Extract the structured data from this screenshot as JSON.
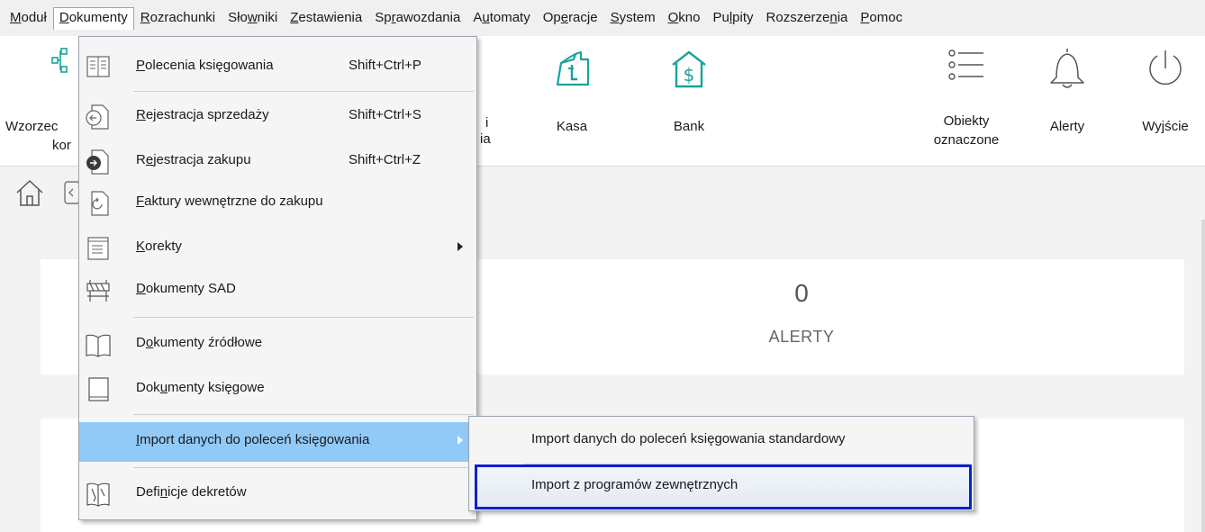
{
  "menubar": {
    "items": [
      {
        "pre": "",
        "u": "M",
        "post": "oduł"
      },
      {
        "pre": "",
        "u": "D",
        "post": "okumenty"
      },
      {
        "pre": "",
        "u": "R",
        "post": "ozrachunki"
      },
      {
        "pre": "Sło",
        "u": "w",
        "post": "niki"
      },
      {
        "pre": "",
        "u": "Z",
        "post": "estawienia"
      },
      {
        "pre": "Sp",
        "u": "r",
        "post": "awozdania"
      },
      {
        "pre": "A",
        "u": "u",
        "post": "tomaty"
      },
      {
        "pre": "Op",
        "u": "e",
        "post": "racje"
      },
      {
        "pre": "",
        "u": "S",
        "post": "ystem"
      },
      {
        "pre": "",
        "u": "O",
        "post": "kno"
      },
      {
        "pre": "Pu",
        "u": "l",
        "post": "pity"
      },
      {
        "pre": "Rozszerze",
        "u": "n",
        "post": "ia"
      },
      {
        "pre": "",
        "u": "P",
        "post": "omoc"
      }
    ]
  },
  "ribbon": {
    "wzorzec_line1": "Wzorzec",
    "wzorzec_line2": "kor",
    "hidden_fragment_1": "i",
    "hidden_fragment_2": "ia",
    "kasa": "Kasa",
    "bank": "Bank",
    "obiekty_line1": "Obiekty",
    "obiekty_line2": "oznaczone",
    "alerty": "Alerty",
    "wyjscie": "Wyjście"
  },
  "dashboard": {
    "alert_count": "0",
    "alert_label": "ALERTY"
  },
  "dropdown": {
    "items": [
      {
        "pre": "",
        "u": "P",
        "post": "olecenia księgowania",
        "shortcut": "Shift+Ctrl+P"
      },
      {
        "pre": "",
        "u": "R",
        "post": "ejestracja sprzedaży",
        "shortcut": "Shift+Ctrl+S"
      },
      {
        "pre": "R",
        "u": "e",
        "post": "jestracja zakupu",
        "shortcut": "Shift+Ctrl+Z"
      },
      {
        "pre": "",
        "u": "F",
        "post": "aktury wewnętrzne do zakupu",
        "shortcut": ""
      },
      {
        "pre": "",
        "u": "K",
        "post": "orekty",
        "shortcut": ""
      },
      {
        "pre": "",
        "u": "D",
        "post": "okumenty SAD",
        "shortcut": ""
      },
      {
        "pre": "D",
        "u": "o",
        "post": "kumenty źródłowe",
        "shortcut": ""
      },
      {
        "pre": "Dok",
        "u": "u",
        "post": "menty księgowe",
        "shortcut": ""
      },
      {
        "pre": "",
        "u": "I",
        "post": "mport danych do poleceń księgowania",
        "shortcut": ""
      },
      {
        "pre": "Defi",
        "u": "n",
        "post": "icje dekretów",
        "shortcut": ""
      }
    ]
  },
  "submenu": {
    "items": [
      {
        "label": "Import danych do poleceń księgowania standardowy"
      },
      {
        "label": "Import z programów zewnętrznych"
      }
    ]
  },
  "colors": {
    "highlight": "#91c9f7",
    "focus_border": "#0a1fd6",
    "icon_teal": "#1aa39a"
  }
}
